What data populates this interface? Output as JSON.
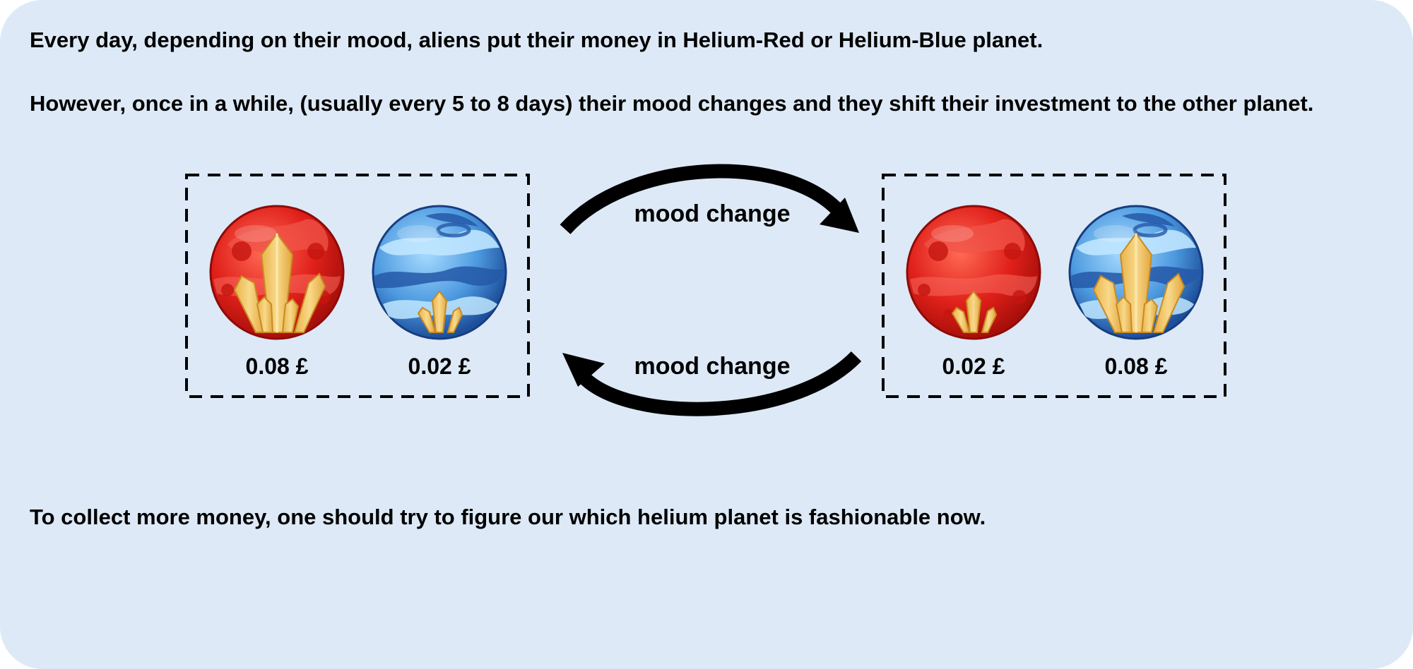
{
  "text": {
    "intro": "Every day, depending on their mood, aliens put their money in Helium-Red or Helium-Blue planet.",
    "shift": "However, once in a while, (usually every 5 to 8 days) their mood changes and they shift their investment to the other planet.",
    "conclusion": "To collect more money, one should try to figure our which helium planet is fashionable now."
  },
  "arrows": {
    "top_label": "mood change",
    "bottom_label": "mood change"
  },
  "left_state": {
    "red_price": "0.08 £",
    "blue_price": "0.02 £",
    "rich_planet": "red"
  },
  "right_state": {
    "red_price": "0.02 £",
    "blue_price": "0.08 £",
    "rich_planet": "blue"
  },
  "colors": {
    "background": "#dde9f6",
    "red_planet": "#e0201a",
    "blue_planet": "#2f78c8",
    "crystal": "#f3c55a"
  },
  "icons": {
    "red_planet": "red-planet-icon",
    "blue_planet": "blue-planet-icon",
    "crystal": "crystal-icon"
  }
}
